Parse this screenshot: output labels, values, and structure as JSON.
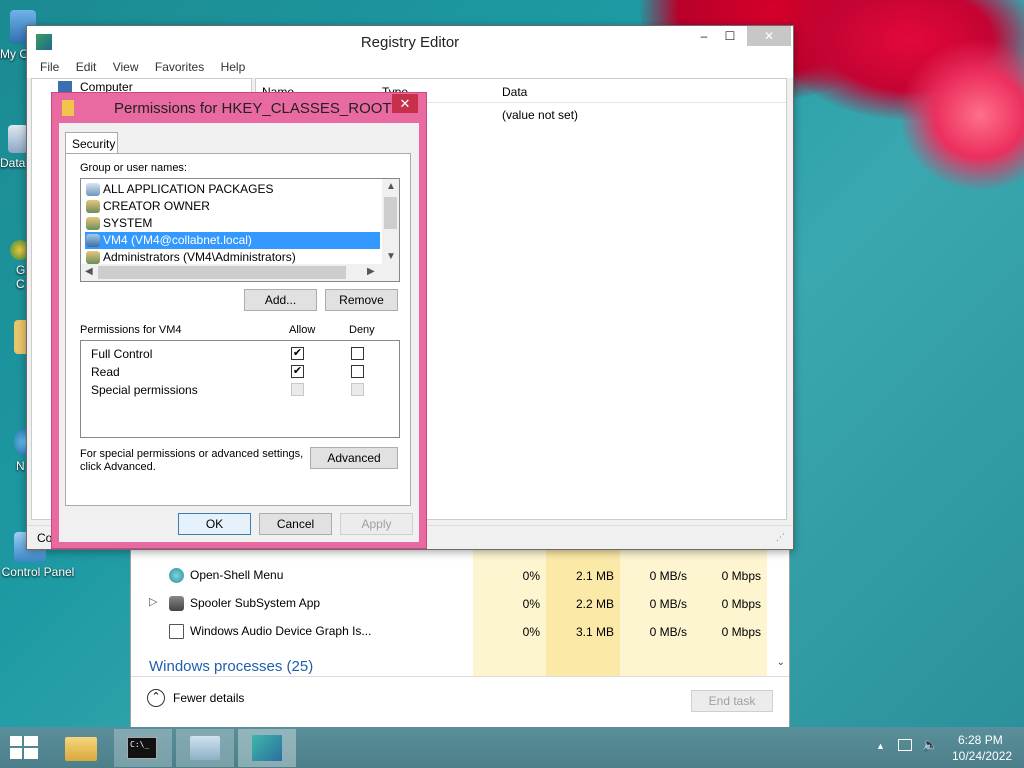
{
  "desktop": {
    "icons": [
      {
        "label": "My C",
        "name": "my-computer"
      },
      {
        "label": "Data",
        "name": "data"
      },
      {
        "label": "G\nC",
        "name": "gc"
      },
      {
        "label": "N",
        "name": "network"
      },
      {
        "label": "Control Panel",
        "name": "control-panel"
      }
    ]
  },
  "regedit": {
    "title": "Registry Editor",
    "menu": [
      "File",
      "Edit",
      "View",
      "Favorites",
      "Help"
    ],
    "tree_root": "Computer",
    "columns": {
      "name": "Name",
      "type": "Type",
      "data": "Data"
    },
    "row_value": "(value not set)",
    "status": "Co"
  },
  "dialog": {
    "title": "Permissions for HKEY_CLASSES_ROOT",
    "tab": "Security",
    "group_label": "Group or user names:",
    "users": [
      {
        "label": "ALL APPLICATION PACKAGES",
        "selected": false
      },
      {
        "label": "CREATOR OWNER",
        "selected": false
      },
      {
        "label": "SYSTEM",
        "selected": false
      },
      {
        "label": "VM4 (VM4@collabnet.local)",
        "selected": true
      },
      {
        "label": "Administrators (VM4\\Administrators)",
        "selected": false
      }
    ],
    "add_button": "Add...",
    "remove_button": "Remove",
    "permissions_for": "Permissions for VM4",
    "allow_header": "Allow",
    "deny_header": "Deny",
    "permissions": [
      {
        "label": "Full Control",
        "allow": true,
        "deny": false,
        "disabled": false
      },
      {
        "label": "Read",
        "allow": true,
        "deny": false,
        "disabled": false
      },
      {
        "label": "Special permissions",
        "allow": false,
        "deny": false,
        "disabled": true
      }
    ],
    "advanced_text_1": "For special permissions or advanced settings,",
    "advanced_text_2": "click Advanced.",
    "advanced_button": "Advanced",
    "ok_button": "OK",
    "cancel_button": "Cancel",
    "apply_button": "Apply"
  },
  "taskmgr": {
    "rows": [
      {
        "name": "Open-Shell Menu",
        "cpu": "0%",
        "mem": "2.1 MB",
        "disk": "0 MB/s",
        "net": "0 Mbps",
        "expandable": false
      },
      {
        "name": "Spooler SubSystem App",
        "cpu": "0%",
        "mem": "2.2 MB",
        "disk": "0 MB/s",
        "net": "0 Mbps",
        "expandable": true
      },
      {
        "name": "Windows Audio Device Graph Is...",
        "cpu": "0%",
        "mem": "3.1 MB",
        "disk": "0 MB/s",
        "net": "0 Mbps",
        "expandable": false
      }
    ],
    "group_heading": "Windows processes (25)",
    "fewer_details": "Fewer details",
    "end_task": "End task"
  },
  "taskbar": {
    "time": "6:28 PM",
    "date": "10/24/2022",
    "cmd_text": "C:\\_"
  }
}
